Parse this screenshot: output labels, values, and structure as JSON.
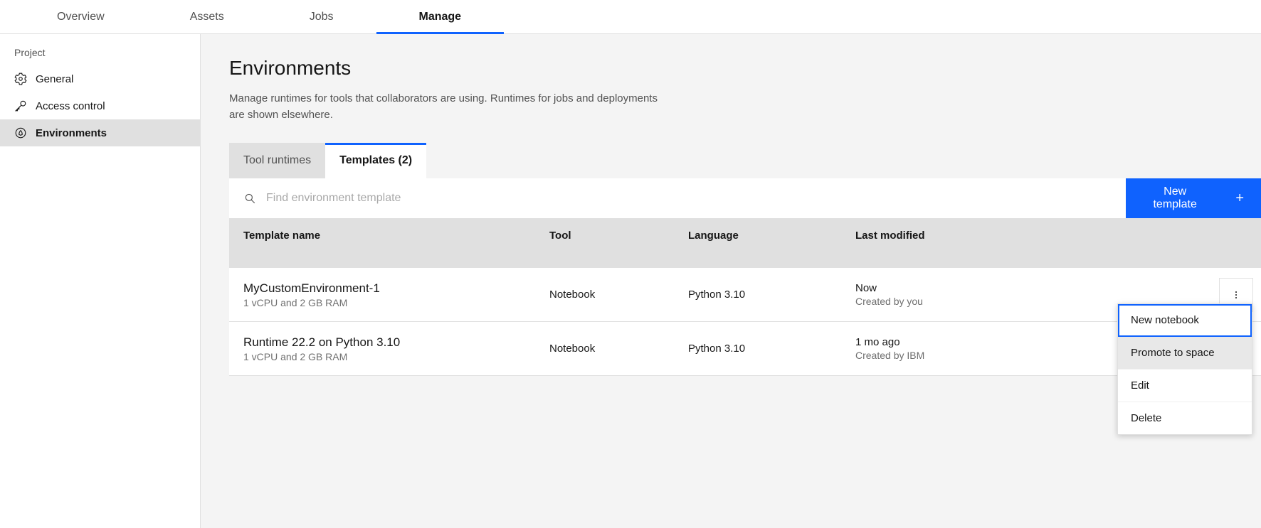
{
  "topTabs": {
    "overview": "Overview",
    "assets": "Assets",
    "jobs": "Jobs",
    "manage": "Manage"
  },
  "sidebar": {
    "heading": "Project",
    "items": [
      {
        "label": "General"
      },
      {
        "label": "Access control"
      },
      {
        "label": "Environments"
      }
    ]
  },
  "page": {
    "title": "Environments",
    "description": "Manage runtimes for tools that collaborators are using. Runtimes for jobs and deployments are shown elsewhere."
  },
  "subTabs": {
    "toolRuntimes": "Tool runtimes",
    "templates": "Templates (2)"
  },
  "toolbar": {
    "searchPlaceholder": "Find environment template",
    "newTemplate": "New template"
  },
  "table": {
    "headers": {
      "name": "Template name",
      "tool": "Tool",
      "language": "Language",
      "modified": "Last modified"
    },
    "rows": [
      {
        "name": "MyCustomEnvironment-1",
        "specs": "1 vCPU and 2 GB RAM",
        "tool": "Notebook",
        "language": "Python 3.10",
        "modified": "Now",
        "modifiedBy": "Created by you"
      },
      {
        "name": "Runtime 22.2 on Python 3.10",
        "specs": "1 vCPU and 2 GB RAM",
        "tool": "Notebook",
        "language": "Python 3.10",
        "modified": "1 mo ago",
        "modifiedBy": "Created by IBM"
      }
    ]
  },
  "menu": {
    "newNotebook": "New notebook",
    "promote": "Promote to space",
    "edit": "Edit",
    "delete": "Delete"
  }
}
